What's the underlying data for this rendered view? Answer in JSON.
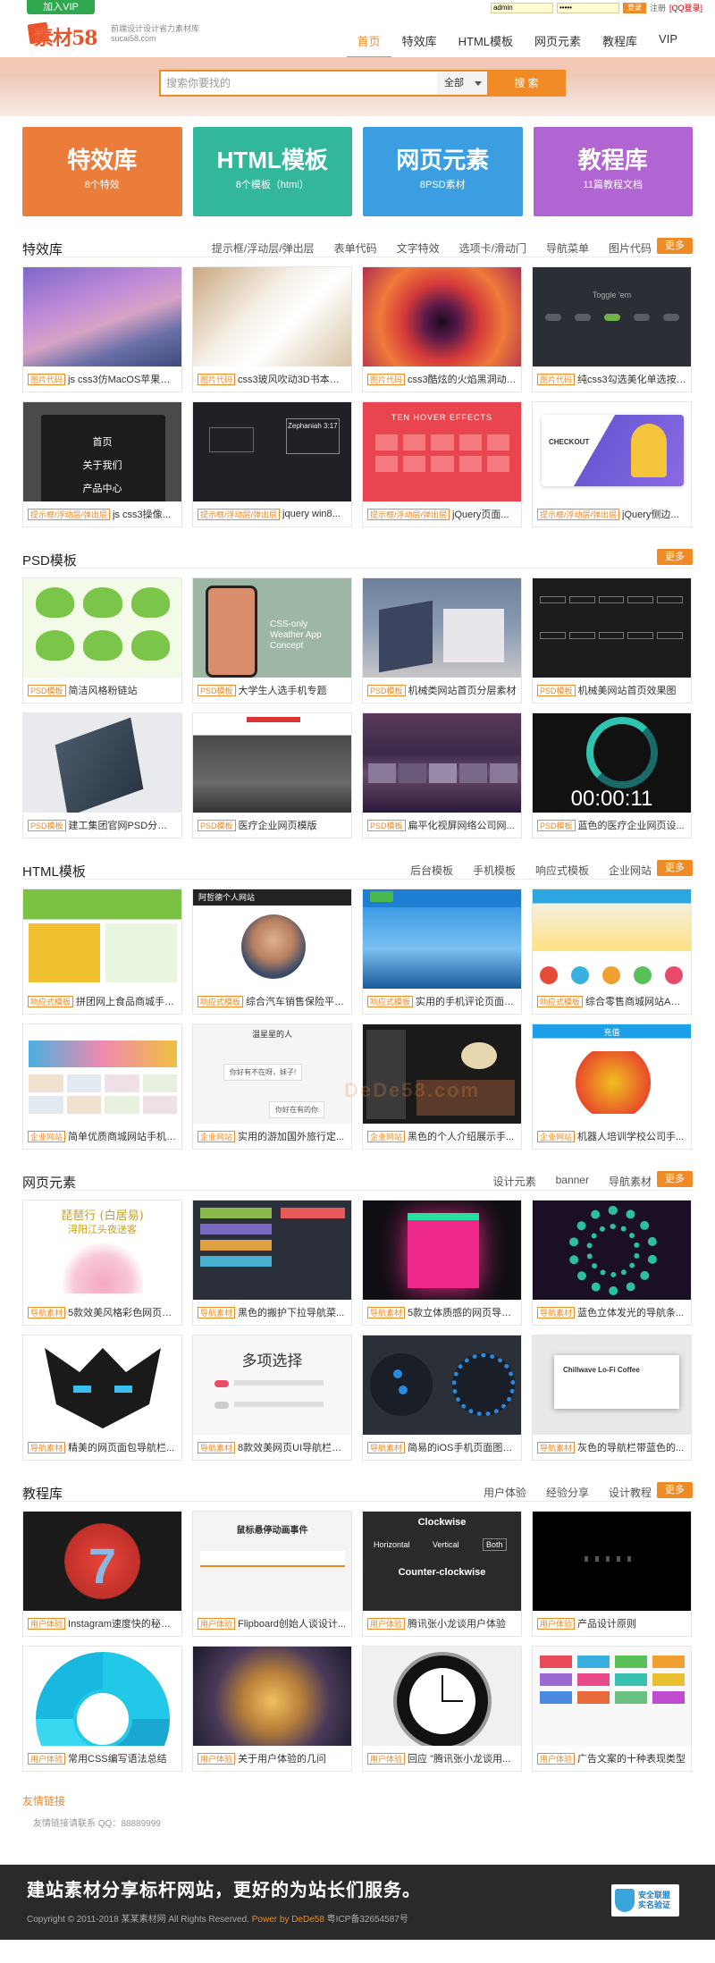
{
  "topbar": {
    "vip_label": "加入VIP",
    "username": "admin",
    "password_mask": "•••••",
    "login_label": "登录",
    "register_label": "注册",
    "qq_login_label": "[QQ登录]"
  },
  "header": {
    "logo_text": "素材58",
    "logo_tagline": "前端设计设计省力素材库",
    "logo_domain": "sucai58.com",
    "nav": [
      "首页",
      "特效库",
      "HTML模板",
      "网页元素",
      "教程库",
      "VIP"
    ]
  },
  "search": {
    "placeholder": "搜索你要找的",
    "category": "全部",
    "button": "搜 索"
  },
  "tiles": [
    {
      "title": "特效库",
      "sub": "8个特效",
      "color": "#ec7c3a"
    },
    {
      "title": "HTML模板",
      "sub": "8个模板（html）",
      "color": "#33b79a"
    },
    {
      "title": "网页元素",
      "sub": "8PSD素材",
      "color": "#3a9ee0"
    },
    {
      "title": "教程库",
      "sub": "11篇教程文档",
      "color": "#b165d2"
    }
  ],
  "more_label": "更多",
  "sections": [
    {
      "title": "特效库",
      "tags": [
        "提示框/浮动层/弹出层",
        "表单代码",
        "文字特效",
        "选项卡/滑动门",
        "导航菜单",
        "图片代码"
      ],
      "cards": [
        {
          "badge": "图片代码",
          "text": "js css3仿MacOS苹果系..."
        },
        {
          "badge": "图片代码",
          "text": "css3玻风吹动3D书本翻..."
        },
        {
          "badge": "图片代码",
          "text": "css3酷炫的火焰黑洞动画..."
        },
        {
          "badge": "图片代码",
          "text": "纯css3勾选美化单选按钮..."
        },
        {
          "badge": "提示框/浮动层/弹出层",
          "text": "js css3操像..."
        },
        {
          "badge": "提示框/浮动层/弹出层",
          "text": "jquery win8..."
        },
        {
          "badge": "提示框/浮动层/弹出层",
          "text": "jQuery页面..."
        },
        {
          "badge": "提示框/浮动层/弹出层",
          "text": "jQuery侧边..."
        }
      ]
    },
    {
      "title": "PSD模板",
      "tags": [],
      "cards": [
        {
          "badge": "PSD模板",
          "text": "简洁风格粉链站"
        },
        {
          "badge": "PSD模板",
          "text": "大学生人选手机专题"
        },
        {
          "badge": "PSD模板",
          "text": "机械类网站首页分层素材"
        },
        {
          "badge": "PSD模板",
          "text": "机械美网站首页效果图"
        },
        {
          "badge": "PSD模板",
          "text": "建工集团官网PSD分层素..."
        },
        {
          "badge": "PSD模板",
          "text": "医疗企业网页模版"
        },
        {
          "badge": "PSD模板",
          "text": "扁平化视屏网络公司网..."
        },
        {
          "badge": "PSD模板",
          "text": "蓝色的医疗企业网页设..."
        }
      ]
    },
    {
      "title": "HTML模板",
      "tags": [
        "后台模板",
        "手机模板",
        "响应式模板",
        "企业网站"
      ],
      "cards": [
        {
          "badge": "响应式模板",
          "text": "拼团网上食品商城手机..."
        },
        {
          "badge": "响应式模板",
          "text": "综合汽车销售保险平台..."
        },
        {
          "badge": "响应式模板",
          "text": "实用的手机评论页面模..."
        },
        {
          "badge": "响应式模板",
          "text": "综合零售商城网站APP..."
        },
        {
          "badge": "企业网站",
          "text": "简单优质商城网站手机人..."
        },
        {
          "badge": "企业网站",
          "text": "实用的游加国外旅行定..."
        },
        {
          "badge": "企业网站",
          "text": "黑色的个人介绍展示手..."
        },
        {
          "badge": "企业网站",
          "text": "机器人培训学校公司手..."
        }
      ]
    },
    {
      "title": "网页元素",
      "tags": [
        "设计元素",
        "banner",
        "导航素材"
      ],
      "cards": [
        {
          "badge": "导航素材",
          "text": "5款效美风格彩色网页导..."
        },
        {
          "badge": "导航素材",
          "text": "黑色的搬护下拉导航菜..."
        },
        {
          "badge": "导航素材",
          "text": "5款立体质感的网页导航..."
        },
        {
          "badge": "导航素材",
          "text": "蓝色立体发光的导航条..."
        },
        {
          "badge": "导航素材",
          "text": "精美的网页面包导航栏..."
        },
        {
          "badge": "导航素材",
          "text": "8款效美网页UI导航栏PS..."
        },
        {
          "badge": "导航素材",
          "text": "简易的iOS手机页面图标..."
        },
        {
          "badge": "导航素材",
          "text": "灰色的导航栏带蓝色的..."
        }
      ]
    },
    {
      "title": "教程库",
      "tags": [
        "用户体验",
        "经验分享",
        "设计教程"
      ],
      "cards": [
        {
          "badge": "用户体验",
          "text": "Instagram速度快的秘密..."
        },
        {
          "badge": "用户体验",
          "text": "Flipboard创始人谈设计..."
        },
        {
          "badge": "用户体验",
          "text": "腾讯张小龙谈用户体验"
        },
        {
          "badge": "用户体验",
          "text": "产品设计原则"
        },
        {
          "badge": "用户体验",
          "text": "常用CSS编写语法总结"
        },
        {
          "badge": "用户体验",
          "text": "关于用户体验的几问"
        },
        {
          "badge": "用户体验",
          "text": "回应 \"腾讯张小龙谈用..."
        },
        {
          "badge": "用户体验",
          "text": "广告文案的十种表现类型"
        }
      ]
    }
  ],
  "thumb_texts": {
    "menu1": "首页",
    "menu2": "关于我们",
    "menu3": "产品中心",
    "toggle": "Toggle 'em",
    "zeph": "Zephaniah 3:17",
    "ten_hover": "TEN HOVER EFFECTS",
    "checkout": "CHECKOUT",
    "weather": "CSS-only Weather App Concept",
    "timer": "00:00:11",
    "personal": "阿哲德个人网站",
    "chat_title": "温星星的人",
    "chat_msg1": "你好有不在呀，妹子!",
    "chat_msg2": "你好在有的你",
    "mobile_title": "充值",
    "poem1": "琵琶行 (白居易)",
    "poem2": "浔阳江头夜送客",
    "multi": "多项选择",
    "coffee": "Chillwave Lo-Fi Coffee",
    "tut_title": "鼠标悬停动画事件",
    "clockwise": "Clockwise",
    "horizontal": "Horizontal",
    "vertical": "Vertical",
    "both": "Both",
    "counter": "Counter-clockwise",
    "seven": "7"
  },
  "friends": {
    "label": "友情链接",
    "contact": "友情链接请联系 QQ：88889999"
  },
  "watermark": "DeDe58.com",
  "footer": {
    "slogan": "建站素材分享标杆网站，更好的为站长们服务。",
    "copyright": "Copyright © 2011-2018 某某素材网 All Rights Reserved.",
    "powered": "Power by DeDe58",
    "icp": "粤ICP备32654587号",
    "seal_line1": "安全联盟",
    "seal_line2": "实名验证"
  },
  "colors": {
    "accent": "#f08a24",
    "vip": "#2fa84f",
    "footer_bg": "#2a2a2a"
  }
}
